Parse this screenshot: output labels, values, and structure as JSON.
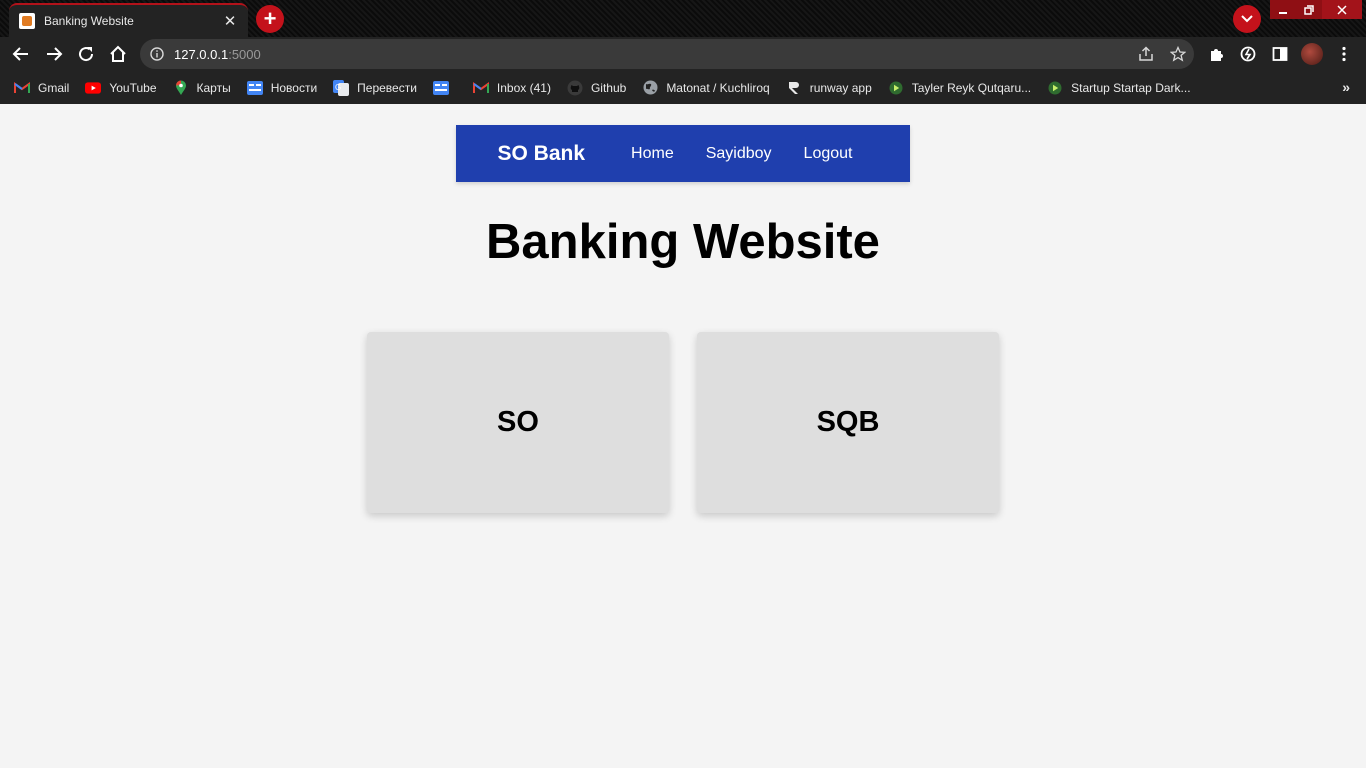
{
  "browser": {
    "tab_title": "Banking Website",
    "url_host": "127.0.0.1",
    "url_port": ":5000",
    "bookmarks": [
      {
        "label": "Gmail",
        "icon": "gmail-icon"
      },
      {
        "label": "YouTube",
        "icon": "youtube-icon"
      },
      {
        "label": "Карты",
        "icon": "maps-icon"
      },
      {
        "label": "Новости",
        "icon": "news-icon"
      },
      {
        "label": "Перевести",
        "icon": "translate-icon"
      },
      {
        "label": "",
        "icon": "news-icon"
      },
      {
        "label": "Inbox (41)",
        "icon": "gmail-icon"
      },
      {
        "label": "Github",
        "icon": "github-icon"
      },
      {
        "label": "Matonat / Kuchliroq",
        "icon": "globe-icon"
      },
      {
        "label": "runway app",
        "icon": "runway-icon"
      },
      {
        "label": "Tayler Reyk Qutqaru...",
        "icon": "play-icon"
      },
      {
        "label": "Startup Startap Dark...",
        "icon": "play-icon"
      }
    ],
    "more_label": "»"
  },
  "site": {
    "brand": "SO Bank",
    "nav": {
      "home": "Home",
      "user": "Sayidboy",
      "logout": "Logout"
    },
    "title": "Banking Website",
    "cards": {
      "first": "SO",
      "second": "SQB"
    }
  },
  "colors": {
    "nav_background": "#1f3fae",
    "page_background": "#f4f4f4",
    "card_background": "#dedede",
    "accent_red": "#c4121b"
  }
}
